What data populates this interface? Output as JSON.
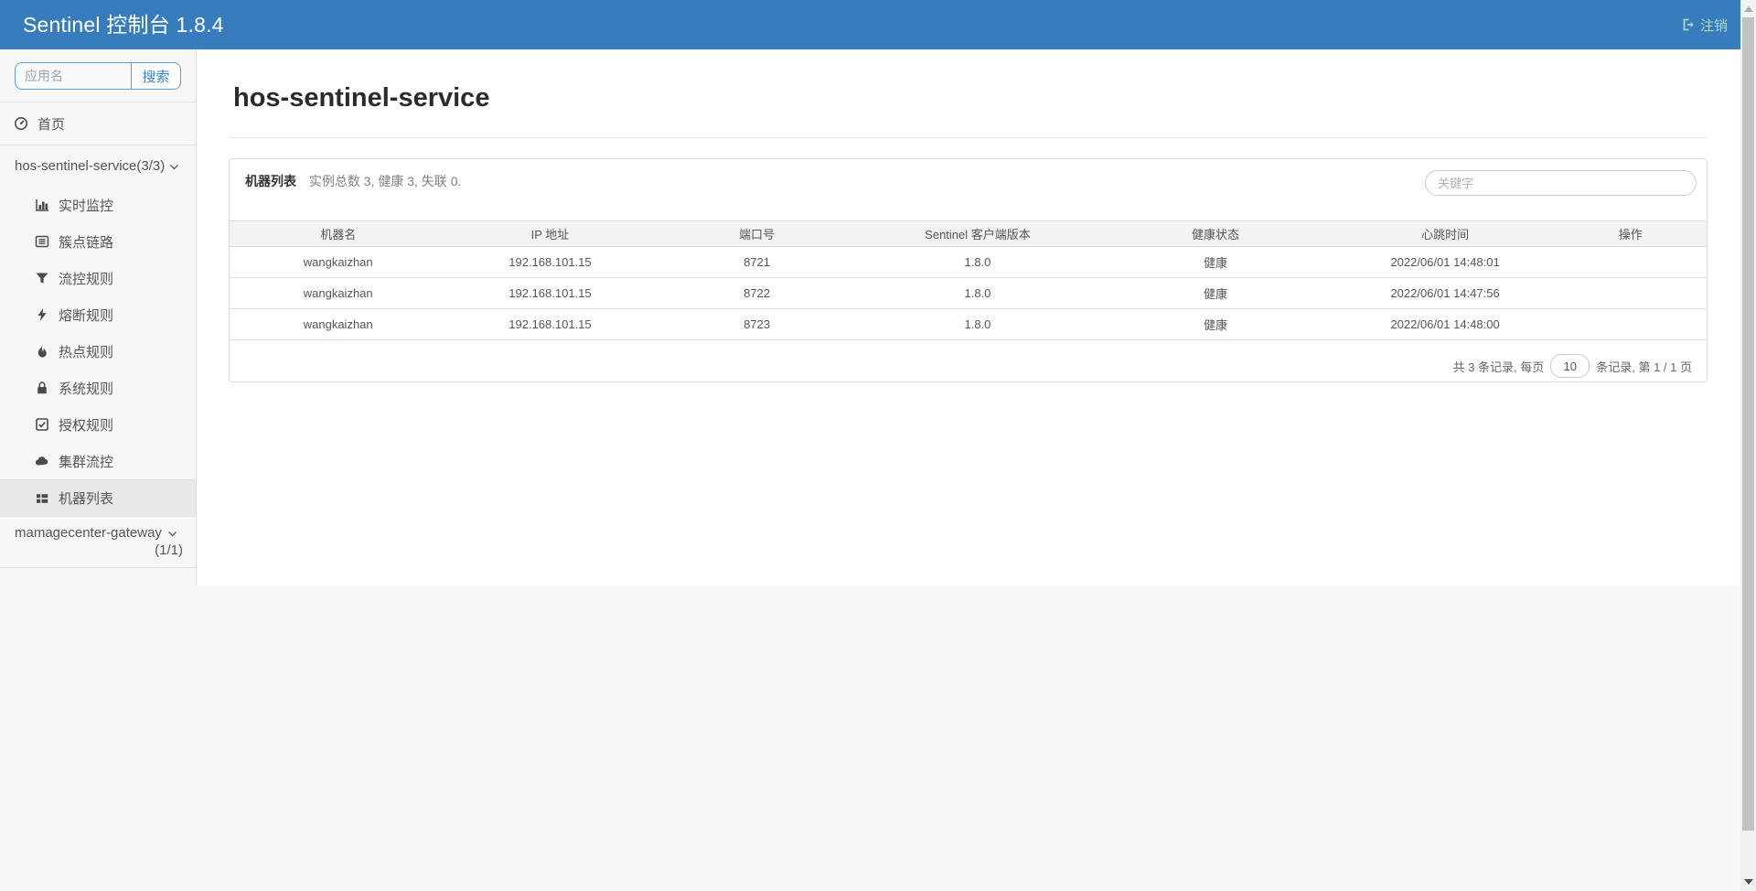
{
  "navbar": {
    "brand": "Sentinel 控制台 1.8.4",
    "logout_label": "注销"
  },
  "sidebar": {
    "search": {
      "placeholder": "应用名",
      "button_label": "搜索"
    },
    "home": {
      "label": "首页",
      "icon": "gauge-icon"
    },
    "group1": {
      "label": "hos-sentinel-service(3/3)",
      "state": "expanded"
    },
    "menu_items": [
      {
        "label": "实时监控",
        "icon": "bar-chart-icon",
        "selected": false
      },
      {
        "label": "簇点链路",
        "icon": "list-alt-icon",
        "selected": false
      },
      {
        "label": "流控规则",
        "icon": "filter-icon",
        "selected": false
      },
      {
        "label": "熔断规则",
        "icon": "bolt-icon",
        "selected": false
      },
      {
        "label": "热点规则",
        "icon": "fire-icon",
        "selected": false
      },
      {
        "label": "系统规则",
        "icon": "lock-icon",
        "selected": false
      },
      {
        "label": "授权规则",
        "icon": "check-square-icon",
        "selected": false
      },
      {
        "label": "集群流控",
        "icon": "cloud-icon",
        "selected": false
      },
      {
        "label": "机器列表",
        "icon": "th-list-icon",
        "selected": true
      }
    ],
    "group2": {
      "label": "mamagecenter-gateway",
      "count": "(1/1)",
      "state": "collapsed"
    }
  },
  "main": {
    "title": "hos-sentinel-service",
    "panel": {
      "title": "机器列表",
      "summary": "实例总数 3, 健康 3, 失联 0.",
      "keyword_placeholder": "关键字",
      "table": {
        "headers": [
          "机器名",
          "IP 地址",
          "端口号",
          "Sentinel 客户端版本",
          "健康状态",
          "心跳时间",
          "操作"
        ],
        "rows": [
          [
            "wangkaizhan",
            "192.168.101.15",
            "8721",
            "1.8.0",
            "健康",
            "2022/06/01 14:48:01",
            ""
          ],
          [
            "wangkaizhan",
            "192.168.101.15",
            "8722",
            "1.8.0",
            "健康",
            "2022/06/01 14:47:56",
            ""
          ],
          [
            "wangkaizhan",
            "192.168.101.15",
            "8723",
            "1.8.0",
            "健康",
            "2022/06/01 14:48:00",
            ""
          ]
        ]
      },
      "pagination": {
        "total_prefix": "共 3 条记录, 每页",
        "page_size": "10",
        "suffix": "条记录, 第 1 / 1 页"
      }
    }
  },
  "colors": {
    "navbar_bg": "#377CBC",
    "logout_text": "#abdcbf",
    "accent_blue": "#3d84c6",
    "sidebar_bg": "#f7f7f7",
    "selected_item_bg": "#e9e9e9"
  }
}
